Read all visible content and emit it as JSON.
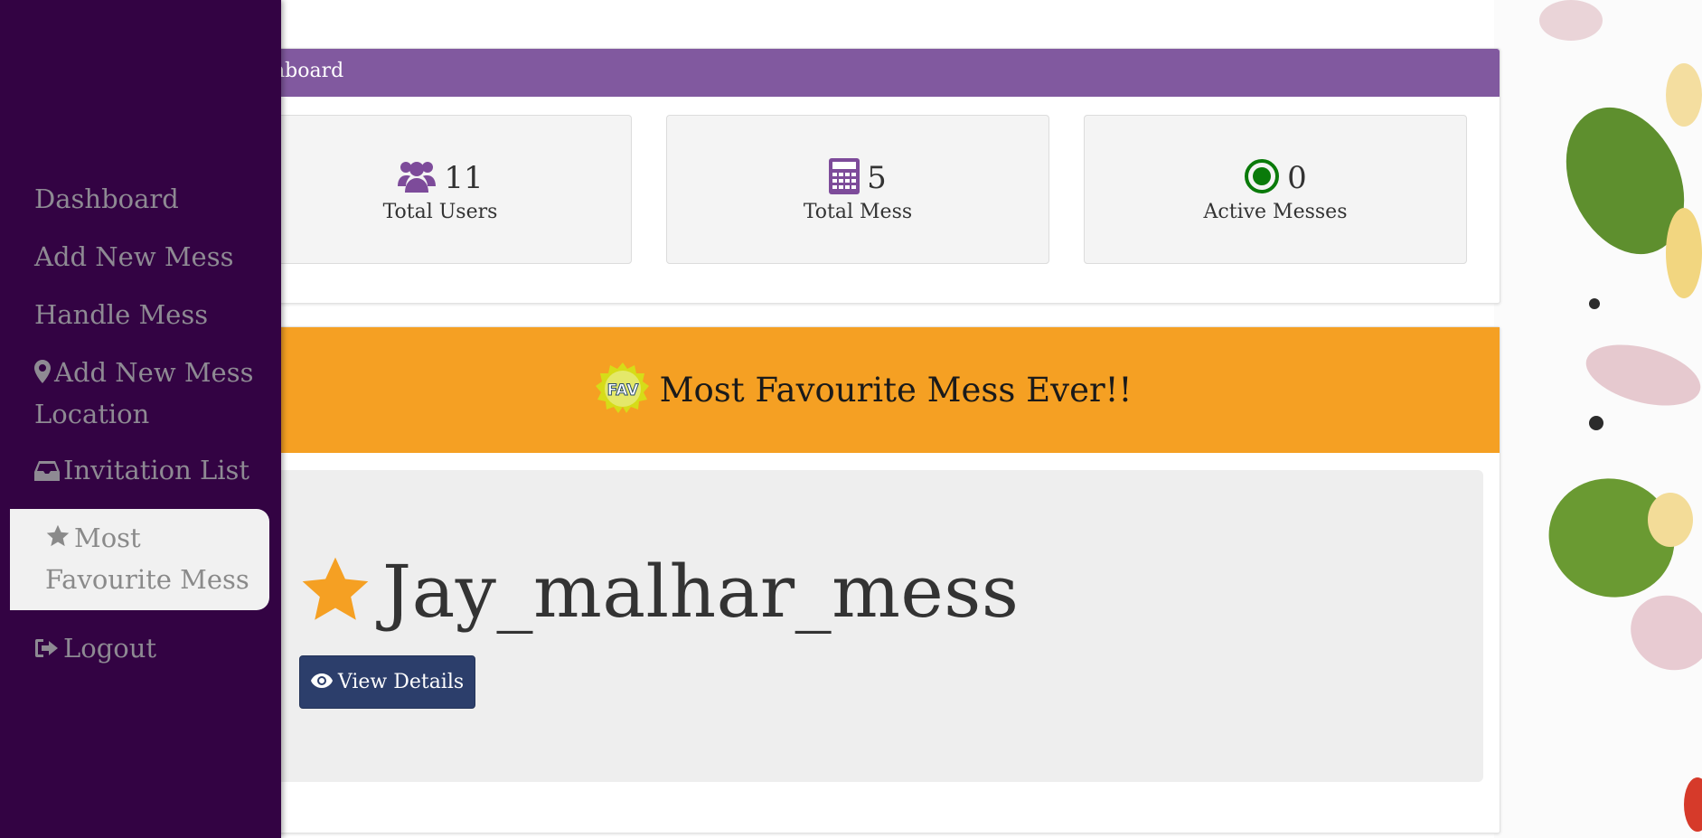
{
  "sidebar": {
    "items": [
      {
        "label": "Dashboard",
        "icon": ""
      },
      {
        "label": "Add New Mess",
        "icon": ""
      },
      {
        "label": "Handle Mess",
        "icon": ""
      },
      {
        "label": "Add New Mess Location",
        "icon": "map-marker-icon"
      },
      {
        "label": "Invitation List",
        "icon": "inbox-icon"
      },
      {
        "label": "Most Favourite Mess",
        "icon": "star-icon"
      },
      {
        "label": "Logout",
        "icon": "sign-out-icon"
      }
    ],
    "active_item": "Most Favourite Mess"
  },
  "dashboard": {
    "header": "nboard",
    "stats": [
      {
        "value": "11",
        "label": "Total Users",
        "icon": "users-icon"
      },
      {
        "value": "5",
        "label": "Total Mess",
        "icon": "calculator-icon"
      },
      {
        "value": "0",
        "label": "Active Messes",
        "icon": "active-dot-icon"
      }
    ]
  },
  "favourite": {
    "banner_title": "Most Favourite Mess Ever!!",
    "badge_text": "FAV",
    "mess_name": "Jay_malhar_mess",
    "view_button": "View Details"
  },
  "colors": {
    "sidebar_bg": "#330343",
    "header_purple": "#81599f",
    "banner_orange": "#f5a023",
    "button_navy": "#2c3e6b",
    "star_orange": "#f5a023",
    "active_green": "#0a7a0a"
  }
}
